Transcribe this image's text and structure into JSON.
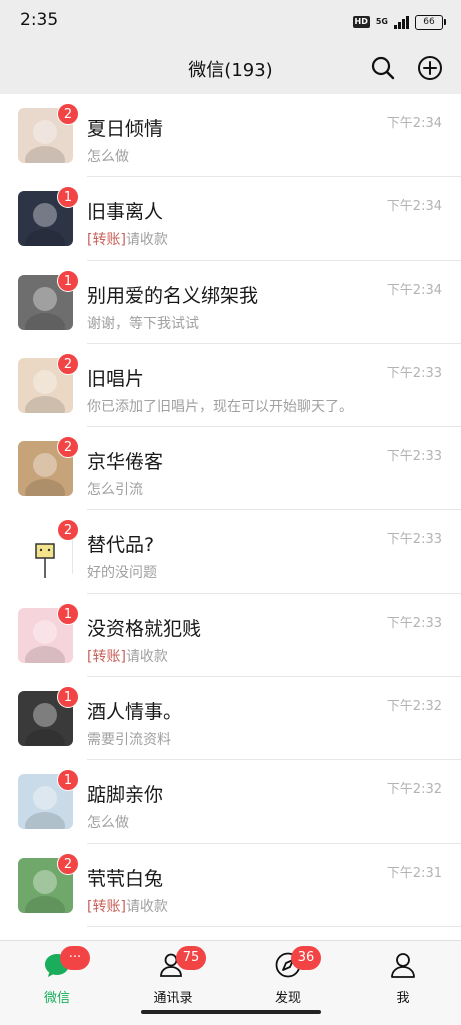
{
  "status_bar": {
    "time": "2:35",
    "hd": "HD",
    "network": "5G",
    "battery": "66"
  },
  "header": {
    "title": "微信(193)",
    "search_icon": "search-icon",
    "add_icon": "plus-circle-icon"
  },
  "chats": [
    {
      "name": "夏日倾情",
      "tag": "",
      "preview": "怎么做",
      "time": "下午2:34",
      "unread": "2",
      "avatar_color": "#e9d8cc"
    },
    {
      "name": "旧事离人",
      "tag": "[转账]",
      "preview": "请收款",
      "time": "下午2:34",
      "unread": "1",
      "avatar_color": "#2d3446"
    },
    {
      "name": "别用爱的名义绑架我",
      "tag": "",
      "preview": "谢谢，等下我试试",
      "time": "下午2:34",
      "unread": "1",
      "avatar_color": "#6e6e6e"
    },
    {
      "name": "旧唱片",
      "tag": "",
      "preview": "你已添加了旧唱片，现在可以开始聊天了。",
      "time": "下午2:33",
      "unread": "2",
      "avatar_color": "#ead8c4"
    },
    {
      "name": "京华倦客",
      "tag": "",
      "preview": "怎么引流",
      "time": "下午2:33",
      "unread": "2",
      "avatar_color": "#c7a37a"
    },
    {
      "name": "替代品?",
      "tag": "",
      "preview": "好的没问题",
      "time": "下午2:33",
      "unread": "2",
      "avatar_color": "#ffffff"
    },
    {
      "name": "没资格就犯贱",
      "tag": "[转账]",
      "preview": "请收款",
      "time": "下午2:33",
      "unread": "1",
      "avatar_color": "#f6d4dc"
    },
    {
      "name": "酒人情事。",
      "tag": "",
      "preview": "需要引流资料",
      "time": "下午2:32",
      "unread": "1",
      "avatar_color": "#3a3a3a"
    },
    {
      "name": "踮脚亲你",
      "tag": "",
      "preview": "怎么做",
      "time": "下午2:32",
      "unread": "1",
      "avatar_color": "#c9dbe8"
    },
    {
      "name": "茕茕白兔",
      "tag": "[转账]",
      "preview": "请收款",
      "time": "下午2:31",
      "unread": "2",
      "avatar_color": "#6fa86a"
    }
  ],
  "tabs": [
    {
      "label": "微信",
      "icon": "chat-bubble-icon",
      "badge": "···",
      "active": true
    },
    {
      "label": "通讯录",
      "icon": "contacts-icon",
      "badge": "75",
      "active": false
    },
    {
      "label": "发现",
      "icon": "compass-icon",
      "badge": "36",
      "active": false
    },
    {
      "label": "我",
      "icon": "person-icon",
      "badge": "",
      "active": false
    }
  ],
  "colors": {
    "accent": "#1aad5b",
    "badge": "#f24444",
    "header_bg": "#ededed"
  }
}
